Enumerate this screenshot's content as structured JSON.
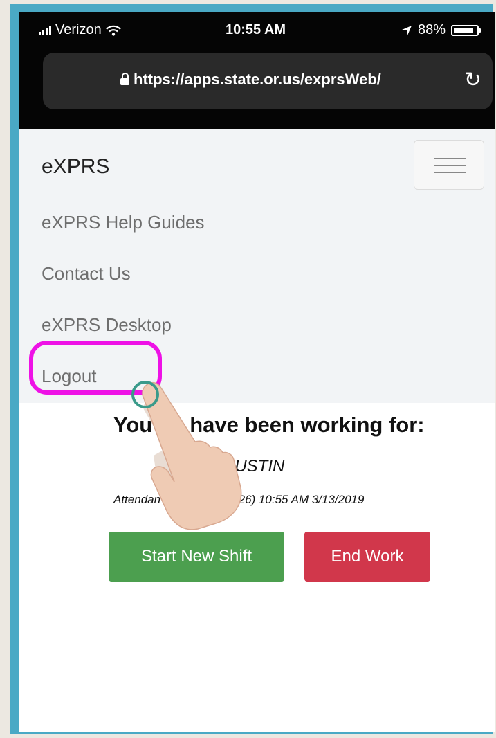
{
  "status_bar": {
    "carrier": "Verizon",
    "time": "10:55 AM",
    "battery": "88%",
    "battery_level": 0.88
  },
  "browser": {
    "url": "https://apps.state.or.us/exprsWeb/"
  },
  "nav": {
    "brand": "eXPRS",
    "links": [
      {
        "label": "eXPRS Help Guides"
      },
      {
        "label": "Contact Us"
      },
      {
        "label": "eXPRS Desktop"
      },
      {
        "label": "Logout"
      }
    ]
  },
  "main": {
    "working_visible": [
      "You",
      "have been working for:"
    ],
    "worker_visible": "ME, JUSTIN",
    "attendance_visible": [
      "Attendan",
      "(OR526) 10:55 AM 3/13/2019"
    ],
    "start_button": "Start New Shift",
    "end_button": "End Work"
  },
  "colors": {
    "frame": "#4aa9c5",
    "highlight": "#ee11e6",
    "start": "#4c9f4f",
    "end": "#d1374b"
  }
}
